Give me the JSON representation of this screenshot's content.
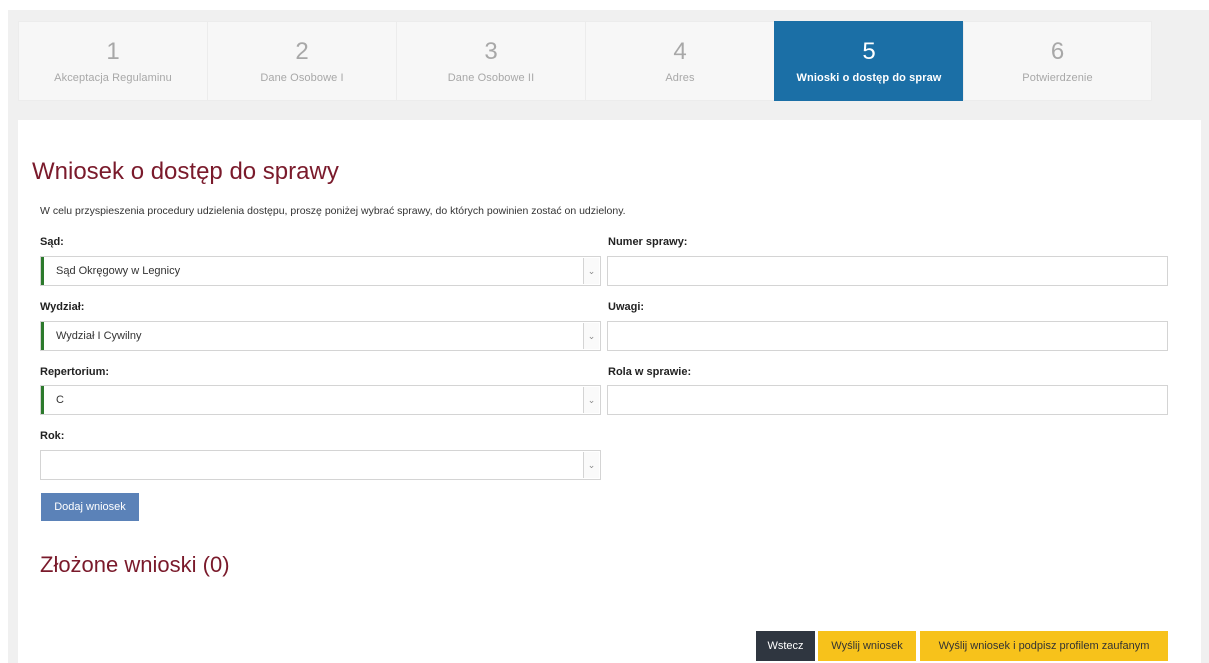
{
  "steps": [
    {
      "num": "1",
      "label": "Akceptacja Regulaminu"
    },
    {
      "num": "2",
      "label": "Dane Osobowe I"
    },
    {
      "num": "3",
      "label": "Dane Osobowe II"
    },
    {
      "num": "4",
      "label": "Adres"
    },
    {
      "num": "5",
      "label": "Wnioski o dostęp do spraw"
    },
    {
      "num": "6",
      "label": "Potwierdzenie"
    }
  ],
  "active_step": 5,
  "form": {
    "title": "Wniosek o dostęp do sprawy",
    "intro": "W celu przyspieszenia procedury udzielenia dostępu, proszę poniżej wybrać sprawy, do których powinien zostać on udzielony.",
    "sad_label": "Sąd:",
    "sad_value": "Sąd Okręgowy w Legnicy",
    "wydzial_label": "Wydział:",
    "wydzial_value": "Wydział I Cywilny",
    "repertorium_label": "Repertorium:",
    "repertorium_value": "C",
    "rok_label": "Rok:",
    "rok_value": "",
    "numer_label": "Numer sprawy:",
    "numer_value": "",
    "uwagi_label": "Uwagi:",
    "uwagi_value": "",
    "rola_label": "Rola w sprawie:",
    "rola_value": "",
    "add_button": "Dodaj wniosek"
  },
  "submitted": {
    "title": "Złożone wnioski (0)"
  },
  "actions": {
    "back": "Wstecz",
    "send": "Wyślij wniosek",
    "send_sign": "Wyślij wniosek i podpisz profilem zaufanym"
  },
  "colors": {
    "active_step": "#1b6fa6",
    "heading": "#7a1a2b",
    "valid_bar": "#2c7a2c",
    "add_button": "#5b82b8",
    "yellow_button": "#f7c21b",
    "dark_button": "#2f3640"
  },
  "icons": {
    "select_arrow": "chevron-down-icon"
  }
}
